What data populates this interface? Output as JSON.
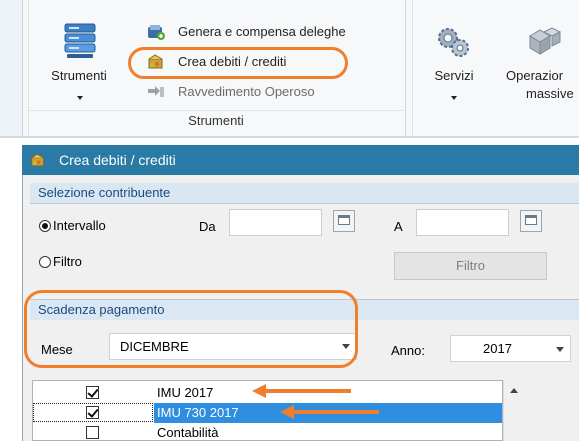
{
  "ribbon": {
    "group_label": "Strumenti",
    "strumenti_label": "Strumenti",
    "items": [
      {
        "label": "Genera e compensa deleghe"
      },
      {
        "label": "Crea debiti / crediti"
      },
      {
        "label": "Ravvedimento Operoso"
      }
    ],
    "servizi_label": "Servizi",
    "operazioni_line1": "Operazior",
    "operazioni_line2": "massive"
  },
  "dialog": {
    "title": "Crea debiti / crediti",
    "close": "✕",
    "selezione": {
      "header": "Selezione contribuente",
      "intervallo_label": "Intervallo",
      "filtro_label": "Filtro",
      "da_label": "Da",
      "a_label": "A",
      "da_value": "",
      "a_value": "",
      "filtro_button": "Filtro",
      "selected": "intervallo"
    },
    "scadenza": {
      "header": "Scadenza pagamento",
      "mese_label": "Mese",
      "mese_value": "DICEMBRE",
      "anno_label": "Anno:",
      "anno_value": "2017"
    },
    "list": [
      {
        "label": "IMU 2017",
        "checked": true,
        "selected": false
      },
      {
        "label": "IMU 730 2017",
        "checked": true,
        "selected": true
      },
      {
        "label": "Contabilità",
        "checked": false,
        "selected": false
      }
    ]
  },
  "colors": {
    "accent_annotation": "#f07f2b",
    "title_bar": "#2a7aa6",
    "selection": "#2f8ee0"
  }
}
